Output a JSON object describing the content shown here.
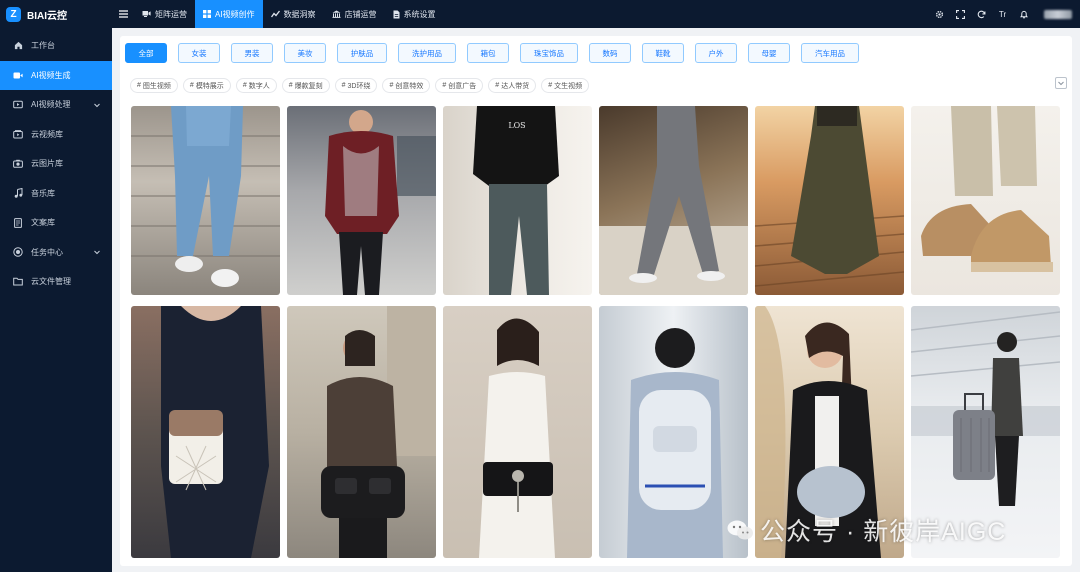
{
  "app": {
    "brand": "BIAI云控",
    "logo_letter": "Z"
  },
  "sidebar": {
    "items": [
      {
        "label": "工作台",
        "icon": "home-icon",
        "active": false,
        "expandable": false
      },
      {
        "label": "AI视频生成",
        "icon": "video-camera-icon",
        "active": true,
        "expandable": false
      },
      {
        "label": "AI视频处理",
        "icon": "video-process-icon",
        "active": false,
        "expandable": true
      },
      {
        "label": "云视频库",
        "icon": "video-library-icon",
        "active": false,
        "expandable": false
      },
      {
        "label": "云图片库",
        "icon": "camera-icon",
        "active": false,
        "expandable": false
      },
      {
        "label": "音乐库",
        "icon": "music-note-icon",
        "active": false,
        "expandable": false
      },
      {
        "label": "文案库",
        "icon": "document-icon",
        "active": false,
        "expandable": false
      },
      {
        "label": "任务中心",
        "icon": "target-icon",
        "active": false,
        "expandable": true
      },
      {
        "label": "云文件管理",
        "icon": "folder-icon",
        "active": false,
        "expandable": false
      }
    ]
  },
  "topbar": {
    "tabs": [
      {
        "label": "矩阵运营",
        "icon": "matrix-icon",
        "active": false
      },
      {
        "label": "AI视频创作",
        "icon": "grid-icon",
        "active": true
      },
      {
        "label": "数据洞察",
        "icon": "trend-icon",
        "active": false
      },
      {
        "label": "店铺运营",
        "icon": "store-icon",
        "active": false
      },
      {
        "label": "系统设置",
        "icon": "settings-file-icon",
        "active": false
      }
    ],
    "right_icons": [
      "gear-icon",
      "fullscreen-icon",
      "refresh-icon",
      "font-size-icon",
      "bell-icon"
    ],
    "font_size_glyph": "Tr"
  },
  "categories": [
    {
      "label": "全部",
      "active": true
    },
    {
      "label": "女装",
      "active": false
    },
    {
      "label": "男装",
      "active": false
    },
    {
      "label": "美妆",
      "active": false
    },
    {
      "label": "护肤品",
      "active": false
    },
    {
      "label": "洗护用品",
      "active": false
    },
    {
      "label": "箱包",
      "active": false
    },
    {
      "label": "珠宝饰品",
      "active": false
    },
    {
      "label": "数码",
      "active": false
    },
    {
      "label": "鞋靴",
      "active": false
    },
    {
      "label": "户外",
      "active": false
    },
    {
      "label": "母婴",
      "active": false
    },
    {
      "label": "汽车用品",
      "active": false
    }
  ],
  "tags": [
    "图生视频",
    "模特展示",
    "数字人",
    "爆款复刻",
    "3D环绕",
    "创意特效",
    "创意广告",
    "达人带货",
    "文生视频"
  ],
  "tag_prefix": "#",
  "cards": [
    {
      "subject": "jeans-stairs"
    },
    {
      "subject": "patterned-shirt-man"
    },
    {
      "subject": "graphic-tee-pants"
    },
    {
      "subject": "grey-trousers-street"
    },
    {
      "subject": "skirt-boardwalk"
    },
    {
      "subject": "beige-sneakers"
    },
    {
      "subject": "quilted-handbag"
    },
    {
      "subject": "black-shoulder-bag"
    },
    {
      "subject": "white-dress-clutch"
    },
    {
      "subject": "white-backpack"
    },
    {
      "subject": "leather-jacket-bag"
    },
    {
      "subject": "luggage-airport"
    }
  ],
  "watermark": {
    "text": "公众号 · 新彼岸AIGC"
  },
  "colors": {
    "primary": "#1890ff",
    "sidebar_bg": "#0c1a30",
    "chip_border": "#91caff"
  }
}
